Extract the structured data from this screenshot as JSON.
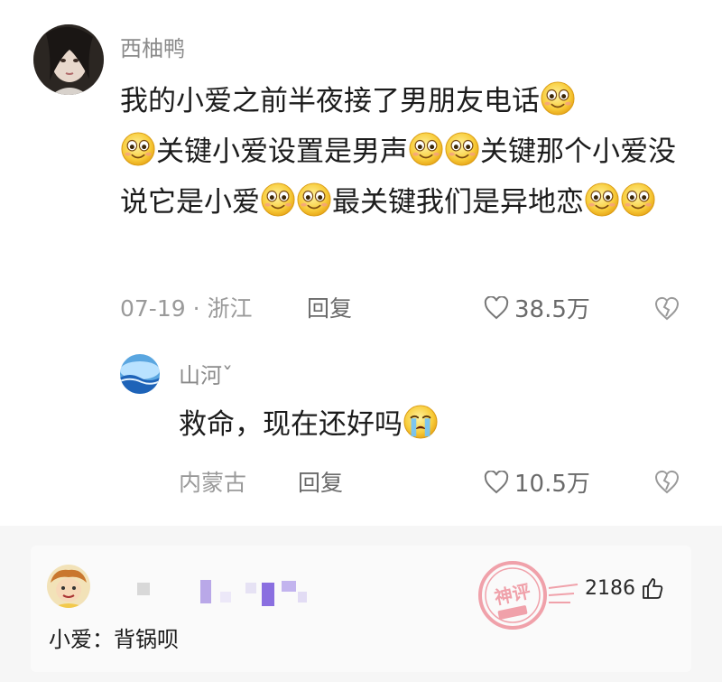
{
  "main_comment": {
    "username": "西柚鸭",
    "segments": [
      "我的小爱之前半夜接了男朋友电话",
      "关键小爱设置是男声",
      "关键那个小爱没说它是小爱",
      "最关键我们是异地恋"
    ],
    "meta": "07-19 · 浙江",
    "reply_label": "回复",
    "likes": "38.5万"
  },
  "reply_comment": {
    "username": "山河ˇ",
    "text": "救命，现在还好吗",
    "location": "内蒙古",
    "reply_label": "回复",
    "likes": "10.5万"
  },
  "bottom_comment": {
    "like_count": "2186",
    "text": "小爱：背锅呗",
    "stamp_text": "神评"
  },
  "icons": [
    "smiling-emoji-icon",
    "crying-emoji-icon",
    "heart-icon",
    "broken-heart-icon",
    "thumbs-up-icon"
  ],
  "colors": {
    "muted_text": "#9a9a9a",
    "stamp": "#e85a6a"
  }
}
